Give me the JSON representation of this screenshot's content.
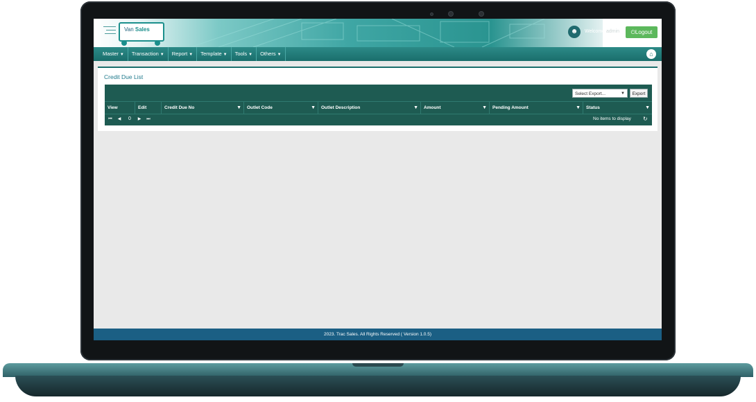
{
  "app": {
    "logo_prefix": "Van",
    "logo_suffix": "Sales"
  },
  "header": {
    "welcome": "Welcome",
    "username": "admin",
    "logout_label": "Logout",
    "logout_icon": "power-icon"
  },
  "nav": {
    "items": [
      {
        "label": "Master"
      },
      {
        "label": "Transaction"
      },
      {
        "label": "Report"
      },
      {
        "label": "Template"
      },
      {
        "label": "Tools"
      },
      {
        "label": "Others"
      }
    ],
    "home_icon": "home-icon"
  },
  "page": {
    "title": "Credit Due List"
  },
  "grid": {
    "select_export": "Select Export...",
    "export_label": "Export",
    "columns": [
      {
        "label": "View"
      },
      {
        "label": "Edit"
      },
      {
        "label": "Credit Due No"
      },
      {
        "label": "Outlet Code"
      },
      {
        "label": "Outlet Description"
      },
      {
        "label": "Amount"
      },
      {
        "label": "Pending Amount"
      },
      {
        "label": "Status"
      }
    ],
    "pager": {
      "page": "0",
      "first": "⏮",
      "prev": "◀",
      "next": "▶",
      "last": "⏭"
    },
    "empty_text": "No items to display"
  },
  "footer": {
    "text": "2023. Trac Sales. All Rights Reserved ( Version 1.0.5)"
  },
  "colors": {
    "primary": "#1a6e6c",
    "grid": "#1e5b52",
    "footer": "#1b5f84",
    "logout": "#5cb85c"
  }
}
